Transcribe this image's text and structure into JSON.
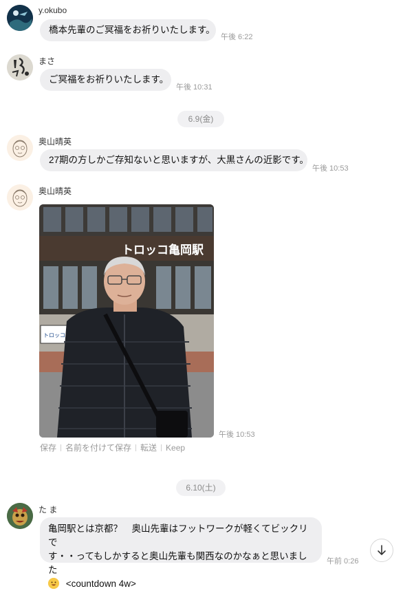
{
  "messages": [
    {
      "sender": "y.okubo",
      "text": "橋本先輩のご冥福をお祈りいたします。",
      "time": "午後 6:22"
    },
    {
      "sender": "まさ",
      "text": "ご冥福をお祈りいたします。",
      "time": "午後 10:31"
    },
    {
      "sender": "奥山晴英",
      "text": "27期の方しかご存知ないと思いますが、大黒さんの近影です。",
      "time": "午後 10:53"
    },
    {
      "sender": "奥山晴英",
      "time": "午後 10:53",
      "image_signs": {
        "station": "トロッコ亀岡駅",
        "board": "トロッコ亀岡駅"
      }
    },
    {
      "sender": "た ま",
      "lines": [
        "亀岡駅とは京都？　奥山先輩はフットワークが軽くてビックリで",
        "す・・ってもしかすると奥山先輩も関西なのかなぁと思いました",
        "<countdown 4w>"
      ],
      "time": "午前 0:26"
    }
  ],
  "dates": [
    "6.9(金)",
    "6.10(土)"
  ],
  "image_actions": [
    "保存",
    "名前を付けて保存",
    "転送",
    "Keep"
  ],
  "colors": {
    "bubble": "#eeeef0",
    "time": "#9a9a9a",
    "pill": "#f1f1f3"
  }
}
